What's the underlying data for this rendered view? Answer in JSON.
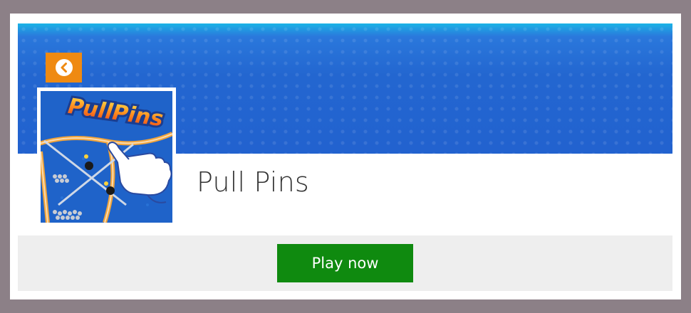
{
  "game": {
    "title": "Pull Pins",
    "thumbnail_text": "PullPins"
  },
  "navigation": {
    "back_icon": "chevron-left-circle-icon"
  },
  "actions": {
    "play_label": "Play now"
  },
  "colors": {
    "page_background": "#8c8087",
    "banner_blue": "#2366d0",
    "back_button": "#ef8a12",
    "play_button": "#0f8a0f",
    "action_bar": "#eeeeee"
  }
}
